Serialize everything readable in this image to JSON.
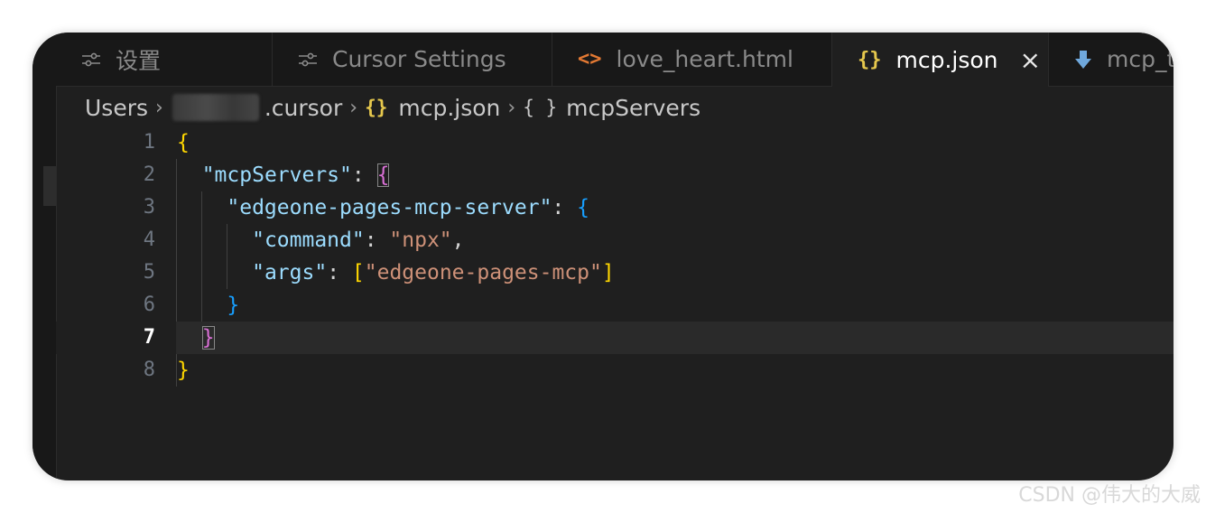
{
  "tabs": [
    {
      "label": "设置",
      "icon": "sliders-icon"
    },
    {
      "label": "Cursor Settings",
      "icon": "sliders-icon"
    },
    {
      "label": "love_heart.html",
      "icon": "code-icon"
    },
    {
      "label": "mcp.json",
      "icon": "json-braces-icon",
      "active": true,
      "close": "×"
    },
    {
      "label": "mcp_t",
      "icon": "download-arrow-icon"
    }
  ],
  "breadcrumb": {
    "users": "Users",
    "cursor": ".cursor",
    "file": "mcp.json",
    "symbol": "mcpServers",
    "braces": "{}",
    "braces_plain": "{ }",
    "sep": "›"
  },
  "editor": {
    "current_line": 7,
    "line_numbers": [
      "1",
      "2",
      "3",
      "4",
      "5",
      "6",
      "7",
      "8"
    ],
    "lines": [
      {
        "indent": "",
        "parts": [
          {
            "t": "{",
            "c": "b1"
          }
        ]
      },
      {
        "indent": "  ",
        "parts": [
          {
            "t": "\"mcpServers\"",
            "c": "key"
          },
          {
            "t": ": ",
            "c": "punc"
          },
          {
            "t": "{",
            "c": "b2 boxed"
          }
        ]
      },
      {
        "indent": "    ",
        "parts": [
          {
            "t": "\"edgeone-pages-mcp-server\"",
            "c": "key"
          },
          {
            "t": ": ",
            "c": "punc"
          },
          {
            "t": "{",
            "c": "b3"
          }
        ]
      },
      {
        "indent": "      ",
        "parts": [
          {
            "t": "\"command\"",
            "c": "key"
          },
          {
            "t": ": ",
            "c": "punc"
          },
          {
            "t": "\"npx\"",
            "c": "str"
          },
          {
            "t": ",",
            "c": "punc"
          }
        ]
      },
      {
        "indent": "      ",
        "parts": [
          {
            "t": "\"args\"",
            "c": "key"
          },
          {
            "t": ": ",
            "c": "punc"
          },
          {
            "t": "[",
            "c": "b1"
          },
          {
            "t": "\"edgeone-pages-mcp\"",
            "c": "str"
          },
          {
            "t": "]",
            "c": "b1"
          }
        ]
      },
      {
        "indent": "    ",
        "parts": [
          {
            "t": "}",
            "c": "b3"
          }
        ]
      },
      {
        "indent": "  ",
        "parts": [
          {
            "t": "}",
            "c": "b2 boxed"
          }
        ]
      },
      {
        "indent": "",
        "parts": [
          {
            "t": "}",
            "c": "b1"
          }
        ]
      }
    ]
  },
  "colors": {
    "key": "#9cdcfe",
    "string": "#ce9178",
    "bracket_level1": "#ffd700",
    "bracket_level2": "#da70d6",
    "bracket_level3": "#179fff"
  },
  "watermark": "CSDN @伟大的大威"
}
